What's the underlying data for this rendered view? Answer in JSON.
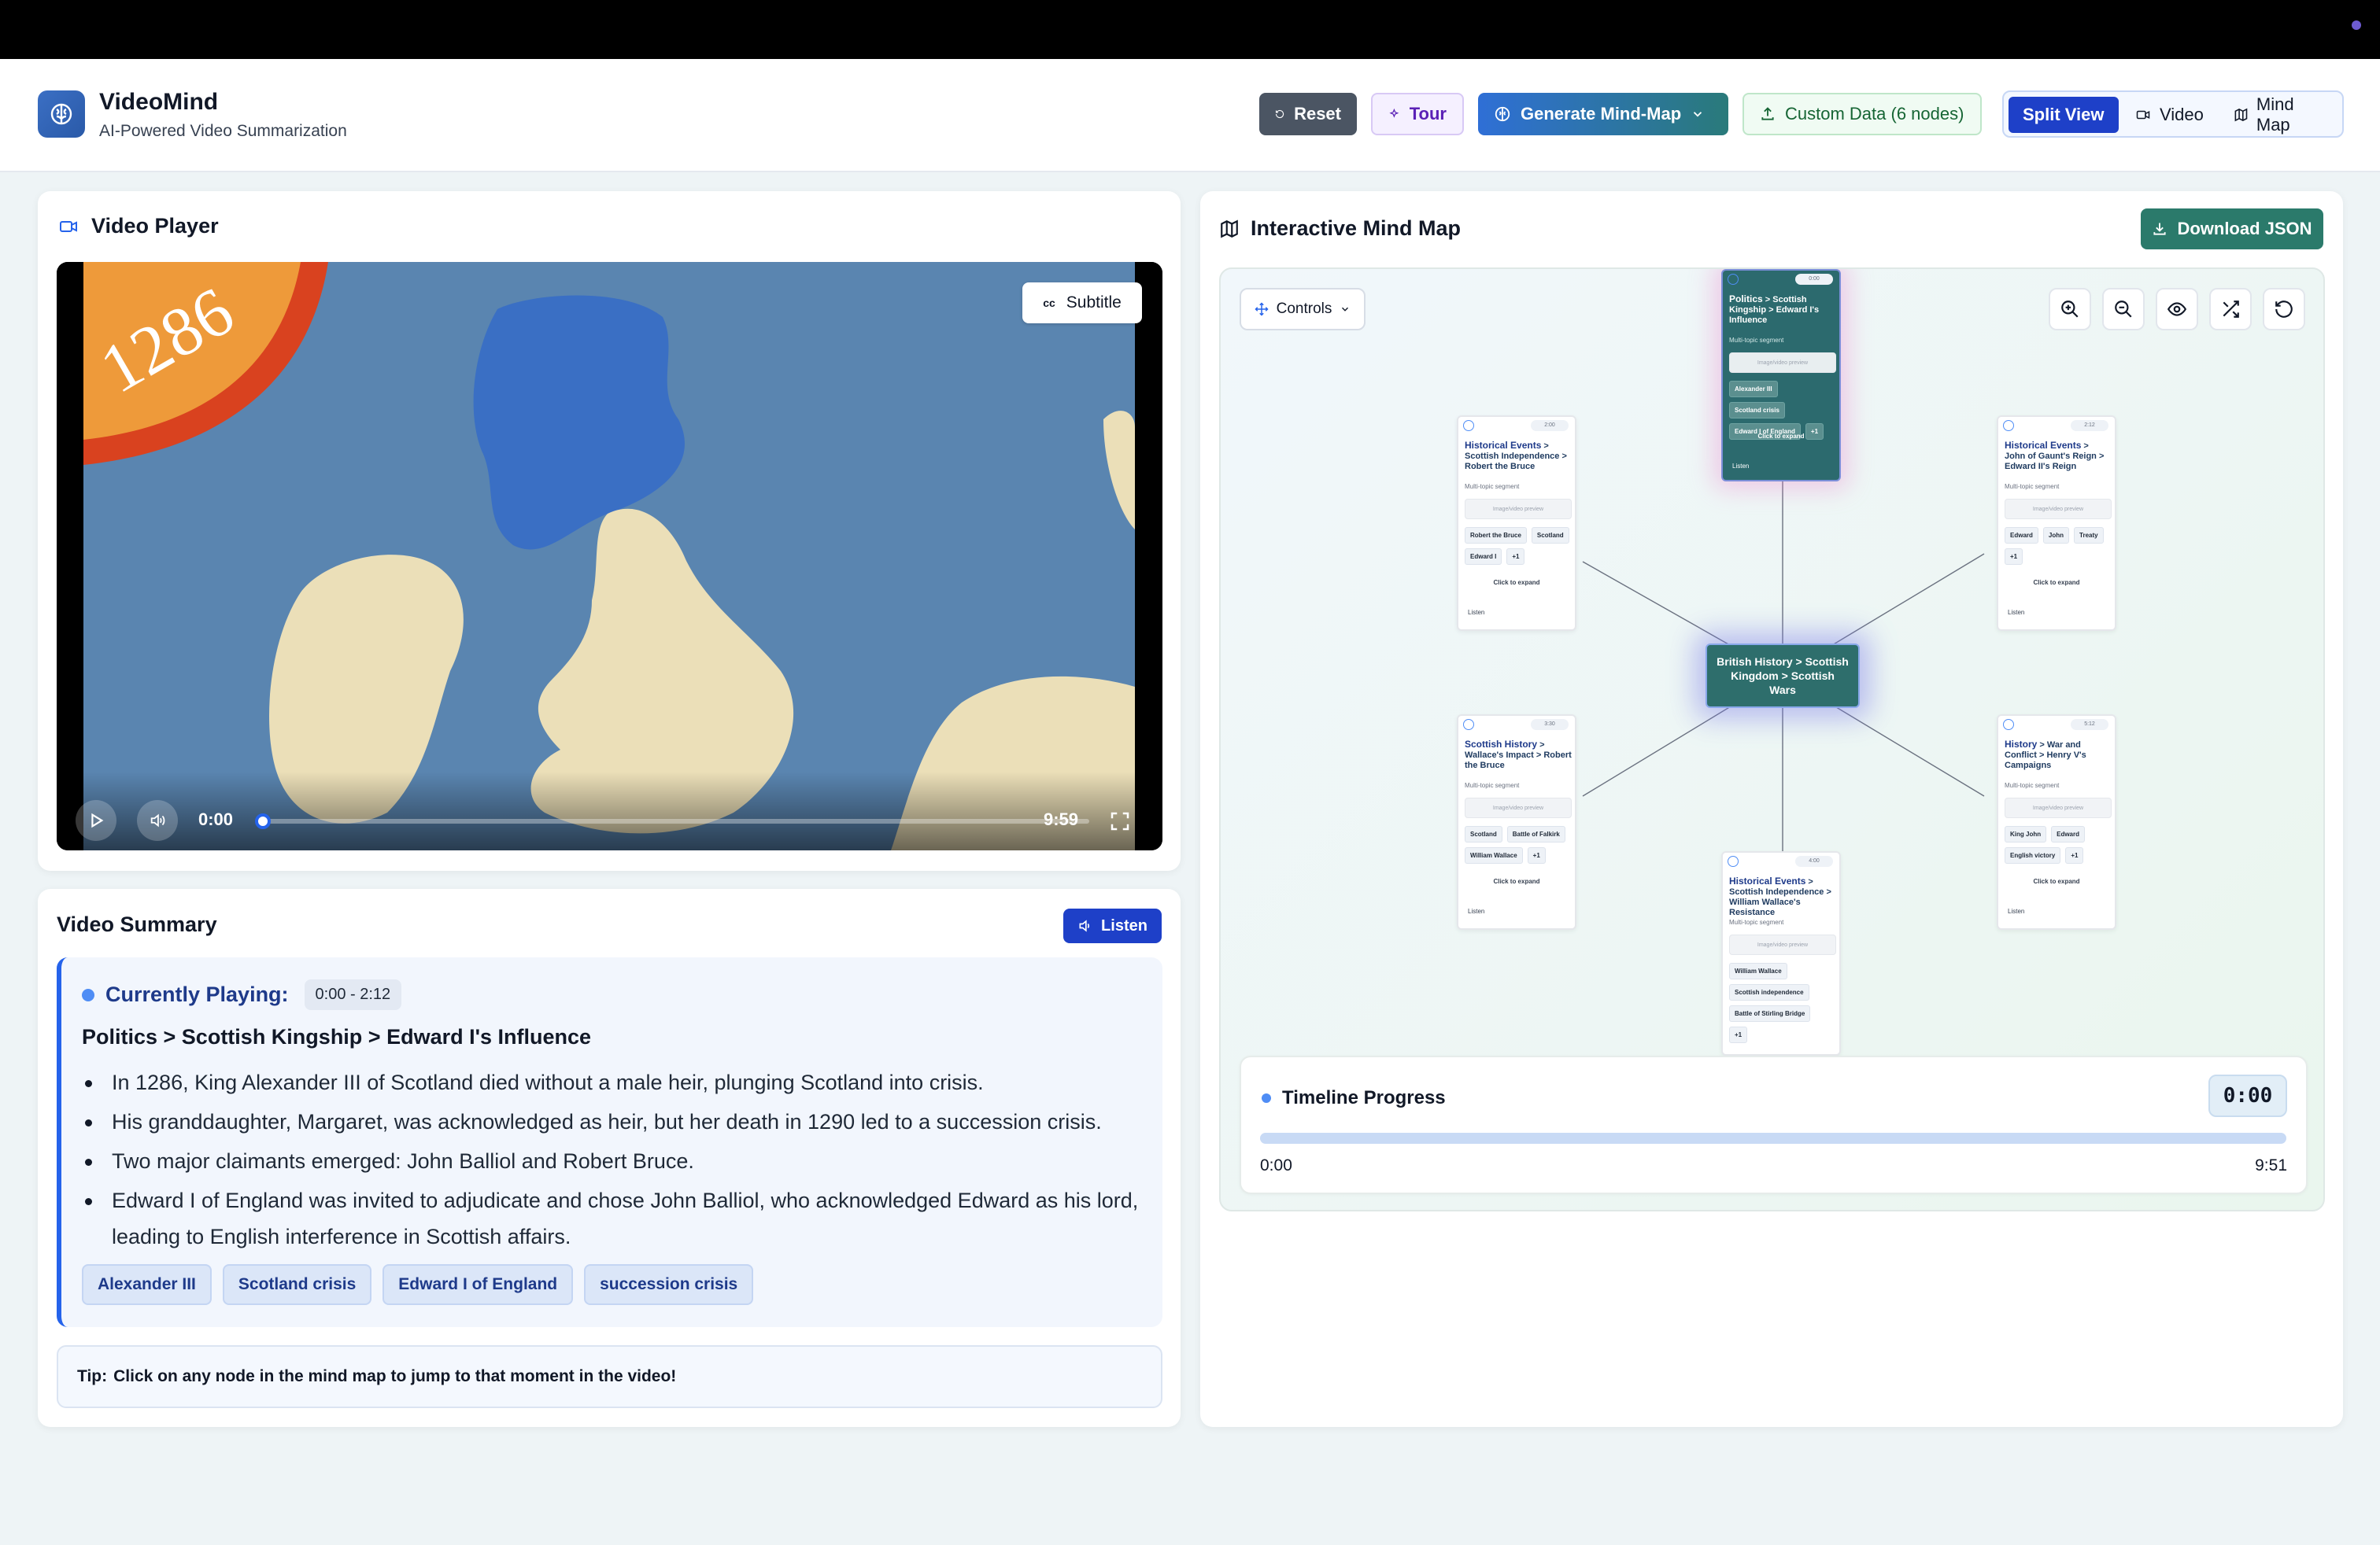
{
  "app": {
    "title": "VideoMind",
    "subtitle": "AI-Powered Video Summarization"
  },
  "header_buttons": {
    "reset": "Reset",
    "tour": "Tour",
    "generate": "Generate Mind-Map",
    "custom": "Custom Data (6 nodes)"
  },
  "view_toggle": {
    "split": "Split View",
    "video": "Video",
    "mindmap": "Mind Map",
    "active": "split"
  },
  "video_player": {
    "title": "Video Player",
    "subtitle_btn": "Subtitle",
    "year_overlay": "1286",
    "current_time": "0:00",
    "duration": "9:59",
    "progress": 0.0
  },
  "summary": {
    "title": "Video Summary",
    "listen": "Listen",
    "currently_playing_label": "Currently Playing:",
    "range": "0:00 - 2:12",
    "segment_title": "Politics > Scottish Kingship > Edward I's Influence",
    "bullets": [
      "In 1286, King Alexander III of Scotland died without a male heir, plunging Scotland into crisis.",
      "His granddaughter, Margaret, was acknowledged as heir, but her death in 1290 led to a succession crisis.",
      "Two major claimants emerged: John Balliol and Robert Bruce.",
      "Edward I of England was invited to adjudicate and chose John Balliol, who acknowledged Edward as his lord, leading to English interference in Scottish affairs."
    ],
    "tags": [
      "Alexander III",
      "Scotland crisis",
      "Edward I of England",
      "succession crisis"
    ],
    "tip_label": "Tip:",
    "tip_text": "Click on any node in the mind map to jump to that moment in the video!"
  },
  "mindmap": {
    "title": "Interactive Mind Map",
    "download": "Download JSON",
    "controls": "Controls",
    "center": "British History > Scottish Kingdom > Scottish Wars",
    "nodes": [
      {
        "head": "Politics",
        "rest": "Scottish Kingship > Edward I's Influence",
        "time": "0:00",
        "sub": "Multi-topic segment",
        "image": "Image/video preview",
        "chips": [
          "Alexander III",
          "Scotland crisis",
          "Edward I of England",
          "+1"
        ],
        "expand": "Click to expand",
        "listen": "Listen",
        "active": true
      },
      {
        "head": "Historical Events",
        "rest": "Scottish Independence > Robert the Bruce",
        "time": "2:00",
        "sub": "Multi-topic segment",
        "image": "Image/video preview",
        "chips": [
          "Robert the Bruce",
          "Scotland",
          "Edward I",
          "+1"
        ],
        "expand": "Click to expand",
        "listen": "Listen",
        "active": false
      },
      {
        "head": "Historical Events",
        "rest": "John of Gaunt's Reign > Edward II's Reign",
        "time": "2:12",
        "sub": "Multi-topic segment",
        "image": "Image/video preview",
        "chips": [
          "Edward",
          "John",
          "Treaty",
          "+1"
        ],
        "expand": "Click to expand",
        "listen": "Listen",
        "active": false
      },
      {
        "head": "Scottish History",
        "rest": "Wallace's Impact > Robert the Bruce",
        "time": "3:30",
        "sub": "Multi-topic segment",
        "image": "Image/video preview",
        "chips": [
          "Scotland",
          "Battle of Falkirk",
          "William Wallace",
          "+1"
        ],
        "expand": "Click to expand",
        "listen": "Listen",
        "active": false
      },
      {
        "head": "History",
        "rest": "War and Conflict > Henry V's Campaigns",
        "time": "5:12",
        "sub": "Multi-topic segment",
        "image": "Image/video preview",
        "chips": [
          "King John",
          "Edward",
          "English victory",
          "+1"
        ],
        "expand": "Click to expand",
        "listen": "Listen",
        "active": false
      },
      {
        "head": "Historical Events",
        "rest": "Scottish Independence > William Wallace's Resistance",
        "time": "4:00",
        "sub": "Multi-topic segment",
        "image": "Image/video preview",
        "chips": [
          "William Wallace",
          "Scottish independence",
          "Battle of Stirling Bridge",
          "+1"
        ],
        "expand": "",
        "listen": "",
        "active": false
      }
    ]
  },
  "timeline": {
    "title": "Timeline Progress",
    "clock": "0:00",
    "start": "0:00",
    "end": "9:51",
    "progress": 0.0
  },
  "colors": {
    "accent": "#1e40c8",
    "teal": "#2b7a6b",
    "sea": "#5a85b0",
    "land": "#ebdfb8",
    "scotland": "#3a6fc4"
  }
}
